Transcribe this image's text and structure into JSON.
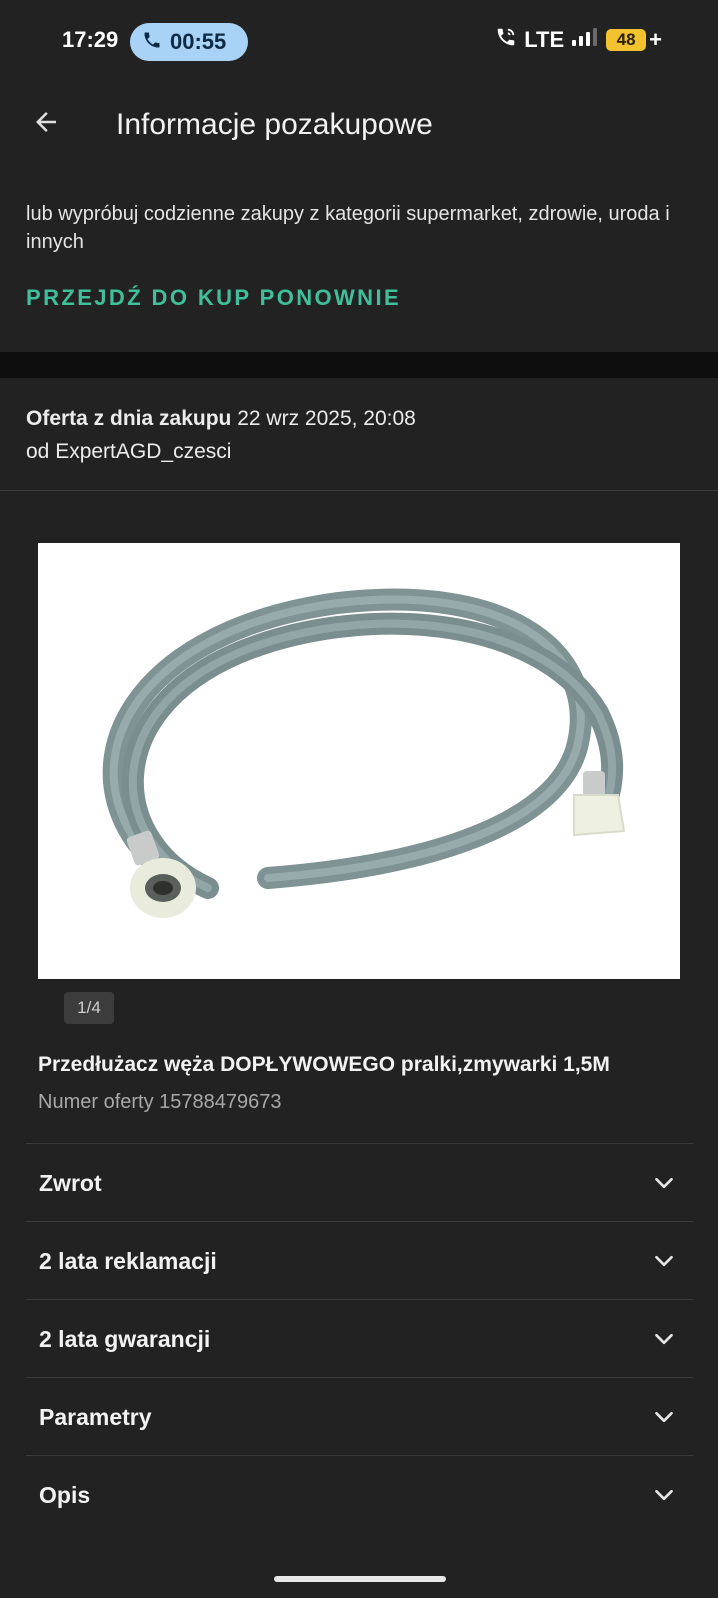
{
  "status_bar": {
    "time": "17:29",
    "call_timer": "00:55",
    "network": "LTE",
    "battery": "48",
    "battery_suffix": "+"
  },
  "header": {
    "title": "Informacje pozakupowe",
    "back_icon": "arrow-left-icon"
  },
  "promo": {
    "text": "lub wypróbuj codzienne zakupy z kategorii supermarket, zdrowie, uroda i innych",
    "link": "PRZEJDŹ DO KUP PONOWNIE"
  },
  "offer": {
    "date_label": "Oferta z dnia zakupu",
    "date_value": "22 wrz 2025, 20:08",
    "seller": "od ExpertAGD_czesci"
  },
  "product": {
    "image_counter": "1/4",
    "title": "Przedłużacz węża DOPŁYWOWEGO pralki,zmywarki 1,5M",
    "offer_number": "Numer oferty 15788479673"
  },
  "sections": [
    {
      "label": "Zwrot"
    },
    {
      "label": "2 lata reklamacji"
    },
    {
      "label": "2 lata gwarancji"
    },
    {
      "label": "Parametry"
    },
    {
      "label": "Opis"
    }
  ],
  "colors": {
    "background": "#222222",
    "accent_link": "#3fbf9a",
    "call_pill": "#a9d3f6",
    "battery": "#f2c230"
  }
}
